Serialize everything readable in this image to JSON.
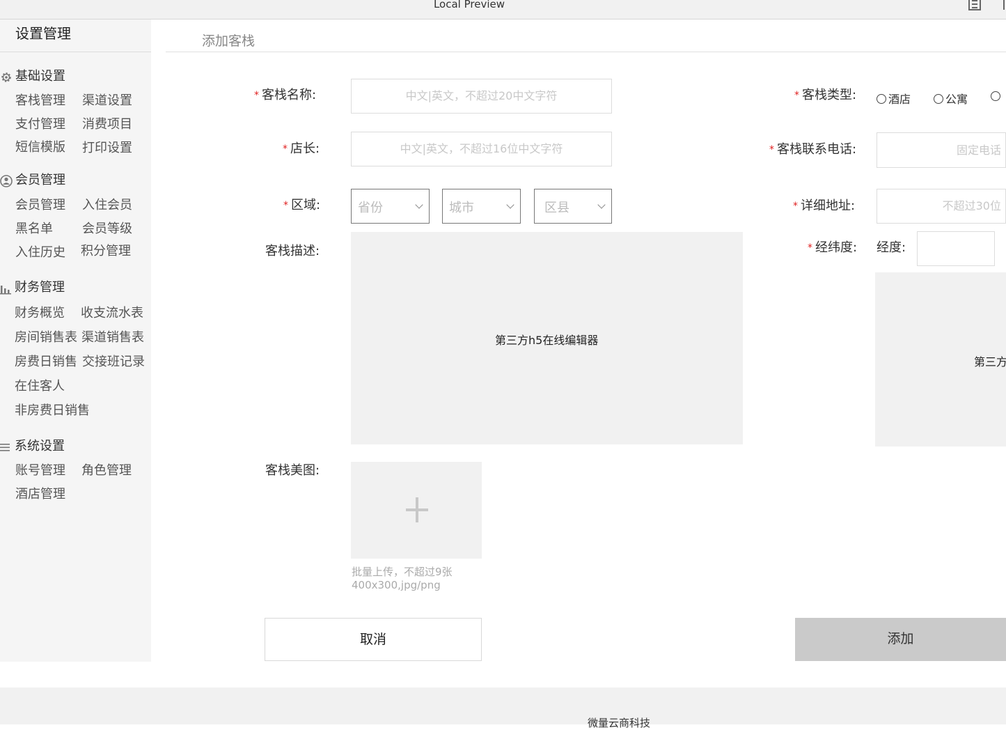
{
  "window": {
    "title": "Local Preview"
  },
  "sidebar": {
    "title": "设置管理",
    "sections": [
      {
        "label": "基础设置",
        "icon": "gear-icon",
        "items": [
          "客栈管理",
          "渠道设置",
          "支付管理",
          "消费项目",
          "短信模版",
          "打印设置"
        ]
      },
      {
        "label": "会员管理",
        "icon": "user-icon",
        "items": [
          "会员管理",
          "入住会员",
          "黑名单",
          "会员等级",
          "入住历史",
          "积分管理"
        ]
      },
      {
        "label": "财务管理",
        "icon": "bar-chart-icon",
        "items": [
          "财务概览",
          "收支流水表",
          "房间销售表",
          "渠道销售表",
          "房费日销售",
          "交接班记录",
          "在住客人",
          "非房费日销售"
        ]
      },
      {
        "label": "系统设置",
        "icon": "menu-icon",
        "items": [
          "账号管理",
          "角色管理",
          "酒店管理"
        ]
      }
    ]
  },
  "main": {
    "title": "添加客栈",
    "form": {
      "name": {
        "label": "客栈名称:",
        "placeholder": "中文|英文，不超过20中文字符"
      },
      "manager": {
        "label": "店长:",
        "placeholder": "中文|英文，不超过16位中文字符"
      },
      "region": {
        "label": "区域:",
        "province": "省份",
        "city": "城市",
        "district": "区县"
      },
      "description": {
        "label": "客栈描述:",
        "editor_text": "第三方h5在线编辑器"
      },
      "images": {
        "label": "客栈美图:",
        "hint_line1": "批量上传，不超过9张",
        "hint_line2": "400x300,jpg/png"
      },
      "type": {
        "label": "客栈类型:",
        "options": [
          "酒店",
          "公寓"
        ]
      },
      "phone": {
        "label": "客栈联系电话:",
        "placeholder": "固定电话"
      },
      "address": {
        "label": "详细地址:",
        "placeholder": "不超过30位"
      },
      "coords": {
        "label": "经纬度:",
        "longitude_label": "经度:"
      },
      "map": {
        "editor_text": "第三方"
      }
    },
    "buttons": {
      "cancel": "取消",
      "add": "添加"
    }
  },
  "footer": {
    "text": "微量云商科技"
  }
}
